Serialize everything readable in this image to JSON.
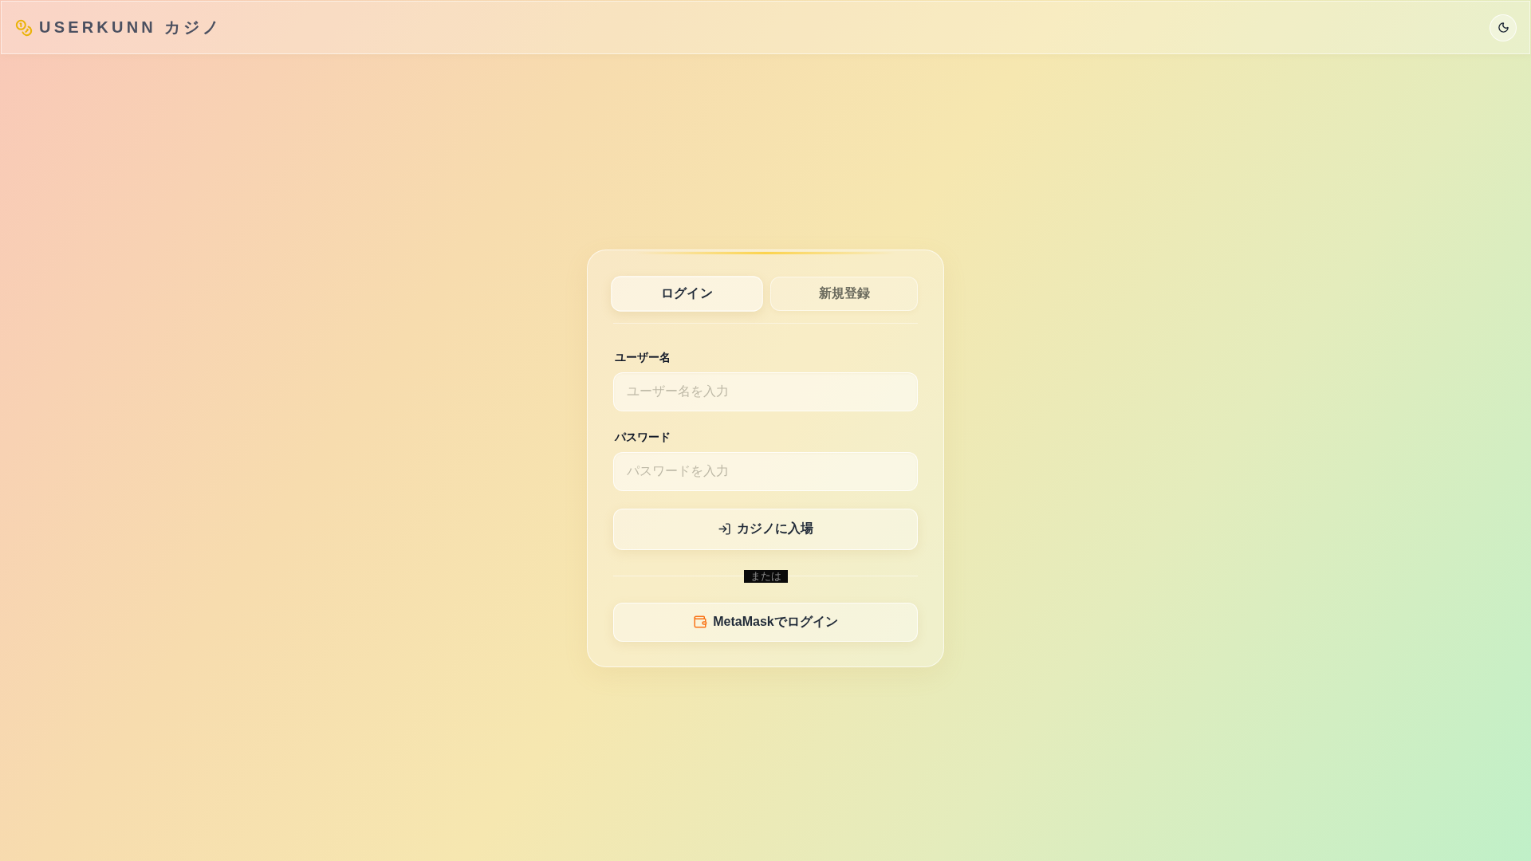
{
  "header": {
    "title": "USERKUNN カジノ"
  },
  "tabs": [
    {
      "label": "ログイン",
      "selected": true
    },
    {
      "label": "新規登録",
      "selected": false
    }
  ],
  "fields": [
    {
      "label": "ユーザー名",
      "placeholder": "ユーザー名を入力"
    },
    {
      "label": "パスワード",
      "placeholder": "パスワードを入力"
    }
  ],
  "submit_button": {
    "label": "カジノに入場"
  },
  "divider": {
    "label": "または"
  },
  "metamask_button": {
    "label": "MetaMaskでログイン"
  }
}
